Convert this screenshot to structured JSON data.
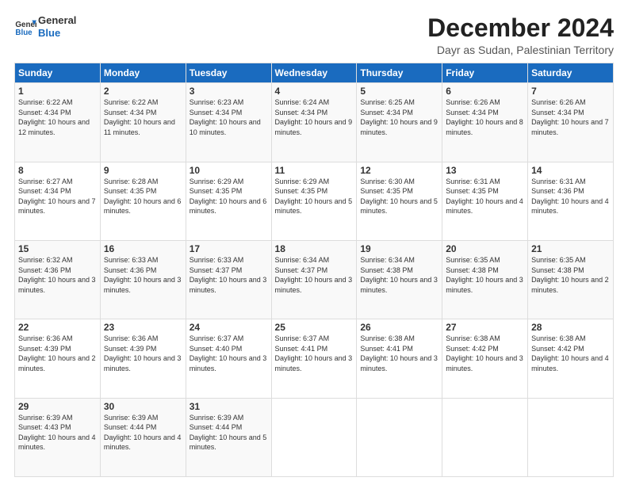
{
  "header": {
    "logo_line1": "General",
    "logo_line2": "Blue",
    "main_title": "December 2024",
    "subtitle": "Dayr as Sudan, Palestinian Territory"
  },
  "days_of_week": [
    "Sunday",
    "Monday",
    "Tuesday",
    "Wednesday",
    "Thursday",
    "Friday",
    "Saturday"
  ],
  "weeks": [
    [
      {
        "day": 1,
        "sunrise": "6:22 AM",
        "sunset": "4:34 PM",
        "daylight": "10 hours and 12 minutes."
      },
      {
        "day": 2,
        "sunrise": "6:22 AM",
        "sunset": "4:34 PM",
        "daylight": "10 hours and 11 minutes."
      },
      {
        "day": 3,
        "sunrise": "6:23 AM",
        "sunset": "4:34 PM",
        "daylight": "10 hours and 10 minutes."
      },
      {
        "day": 4,
        "sunrise": "6:24 AM",
        "sunset": "4:34 PM",
        "daylight": "10 hours and 9 minutes."
      },
      {
        "day": 5,
        "sunrise": "6:25 AM",
        "sunset": "4:34 PM",
        "daylight": "10 hours and 9 minutes."
      },
      {
        "day": 6,
        "sunrise": "6:26 AM",
        "sunset": "4:34 PM",
        "daylight": "10 hours and 8 minutes."
      },
      {
        "day": 7,
        "sunrise": "6:26 AM",
        "sunset": "4:34 PM",
        "daylight": "10 hours and 7 minutes."
      }
    ],
    [
      {
        "day": 8,
        "sunrise": "6:27 AM",
        "sunset": "4:34 PM",
        "daylight": "10 hours and 7 minutes."
      },
      {
        "day": 9,
        "sunrise": "6:28 AM",
        "sunset": "4:35 PM",
        "daylight": "10 hours and 6 minutes."
      },
      {
        "day": 10,
        "sunrise": "6:29 AM",
        "sunset": "4:35 PM",
        "daylight": "10 hours and 6 minutes."
      },
      {
        "day": 11,
        "sunrise": "6:29 AM",
        "sunset": "4:35 PM",
        "daylight": "10 hours and 5 minutes."
      },
      {
        "day": 12,
        "sunrise": "6:30 AM",
        "sunset": "4:35 PM",
        "daylight": "10 hours and 5 minutes."
      },
      {
        "day": 13,
        "sunrise": "6:31 AM",
        "sunset": "4:35 PM",
        "daylight": "10 hours and 4 minutes."
      },
      {
        "day": 14,
        "sunrise": "6:31 AM",
        "sunset": "4:36 PM",
        "daylight": "10 hours and 4 minutes."
      }
    ],
    [
      {
        "day": 15,
        "sunrise": "6:32 AM",
        "sunset": "4:36 PM",
        "daylight": "10 hours and 3 minutes."
      },
      {
        "day": 16,
        "sunrise": "6:33 AM",
        "sunset": "4:36 PM",
        "daylight": "10 hours and 3 minutes."
      },
      {
        "day": 17,
        "sunrise": "6:33 AM",
        "sunset": "4:37 PM",
        "daylight": "10 hours and 3 minutes."
      },
      {
        "day": 18,
        "sunrise": "6:34 AM",
        "sunset": "4:37 PM",
        "daylight": "10 hours and 3 minutes."
      },
      {
        "day": 19,
        "sunrise": "6:34 AM",
        "sunset": "4:38 PM",
        "daylight": "10 hours and 3 minutes."
      },
      {
        "day": 20,
        "sunrise": "6:35 AM",
        "sunset": "4:38 PM",
        "daylight": "10 hours and 3 minutes."
      },
      {
        "day": 21,
        "sunrise": "6:35 AM",
        "sunset": "4:38 PM",
        "daylight": "10 hours and 2 minutes."
      }
    ],
    [
      {
        "day": 22,
        "sunrise": "6:36 AM",
        "sunset": "4:39 PM",
        "daylight": "10 hours and 2 minutes."
      },
      {
        "day": 23,
        "sunrise": "6:36 AM",
        "sunset": "4:39 PM",
        "daylight": "10 hours and 3 minutes."
      },
      {
        "day": 24,
        "sunrise": "6:37 AM",
        "sunset": "4:40 PM",
        "daylight": "10 hours and 3 minutes."
      },
      {
        "day": 25,
        "sunrise": "6:37 AM",
        "sunset": "4:41 PM",
        "daylight": "10 hours and 3 minutes."
      },
      {
        "day": 26,
        "sunrise": "6:38 AM",
        "sunset": "4:41 PM",
        "daylight": "10 hours and 3 minutes."
      },
      {
        "day": 27,
        "sunrise": "6:38 AM",
        "sunset": "4:42 PM",
        "daylight": "10 hours and 3 minutes."
      },
      {
        "day": 28,
        "sunrise": "6:38 AM",
        "sunset": "4:42 PM",
        "daylight": "10 hours and 4 minutes."
      }
    ],
    [
      {
        "day": 29,
        "sunrise": "6:39 AM",
        "sunset": "4:43 PM",
        "daylight": "10 hours and 4 minutes."
      },
      {
        "day": 30,
        "sunrise": "6:39 AM",
        "sunset": "4:44 PM",
        "daylight": "10 hours and 4 minutes."
      },
      {
        "day": 31,
        "sunrise": "6:39 AM",
        "sunset": "4:44 PM",
        "daylight": "10 hours and 5 minutes."
      },
      null,
      null,
      null,
      null
    ]
  ]
}
